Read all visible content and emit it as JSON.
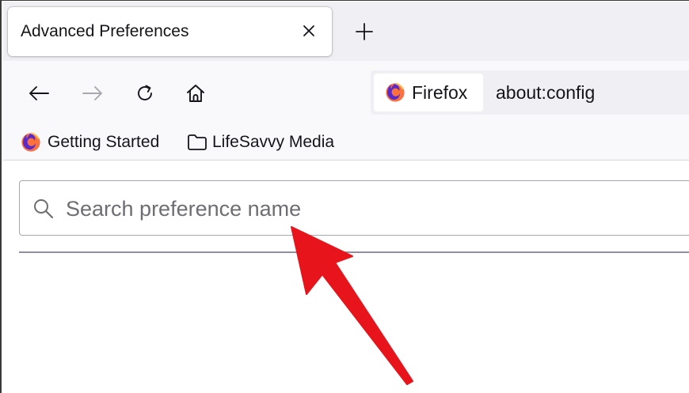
{
  "window": {
    "active_tab": {
      "title": "Advanced Preferences"
    },
    "close_tab_icon": "close-icon",
    "new_tab_icon": "plus-icon"
  },
  "nav": {
    "back_icon": "arrow-left-icon",
    "forward_icon": "arrow-right-icon",
    "reload_icon": "reload-icon",
    "home_icon": "home-icon",
    "identity_label": "Firefox",
    "url": "about:config"
  },
  "bookmarks": {
    "items": [
      {
        "label": "Getting Started",
        "icon": "firefox-logo-icon"
      },
      {
        "label": "LifeSavvy Media",
        "icon": "folder-icon"
      }
    ]
  },
  "content": {
    "search": {
      "placeholder": "Search preference name",
      "value": ""
    }
  },
  "colors": {
    "tabstrip_bg": "#f0f0f4",
    "toolbar_bg": "#f9f9fb",
    "annotation_arrow": "#e8141b",
    "firefox_orange": "#ff7139",
    "firefox_purple": "#592acb"
  }
}
